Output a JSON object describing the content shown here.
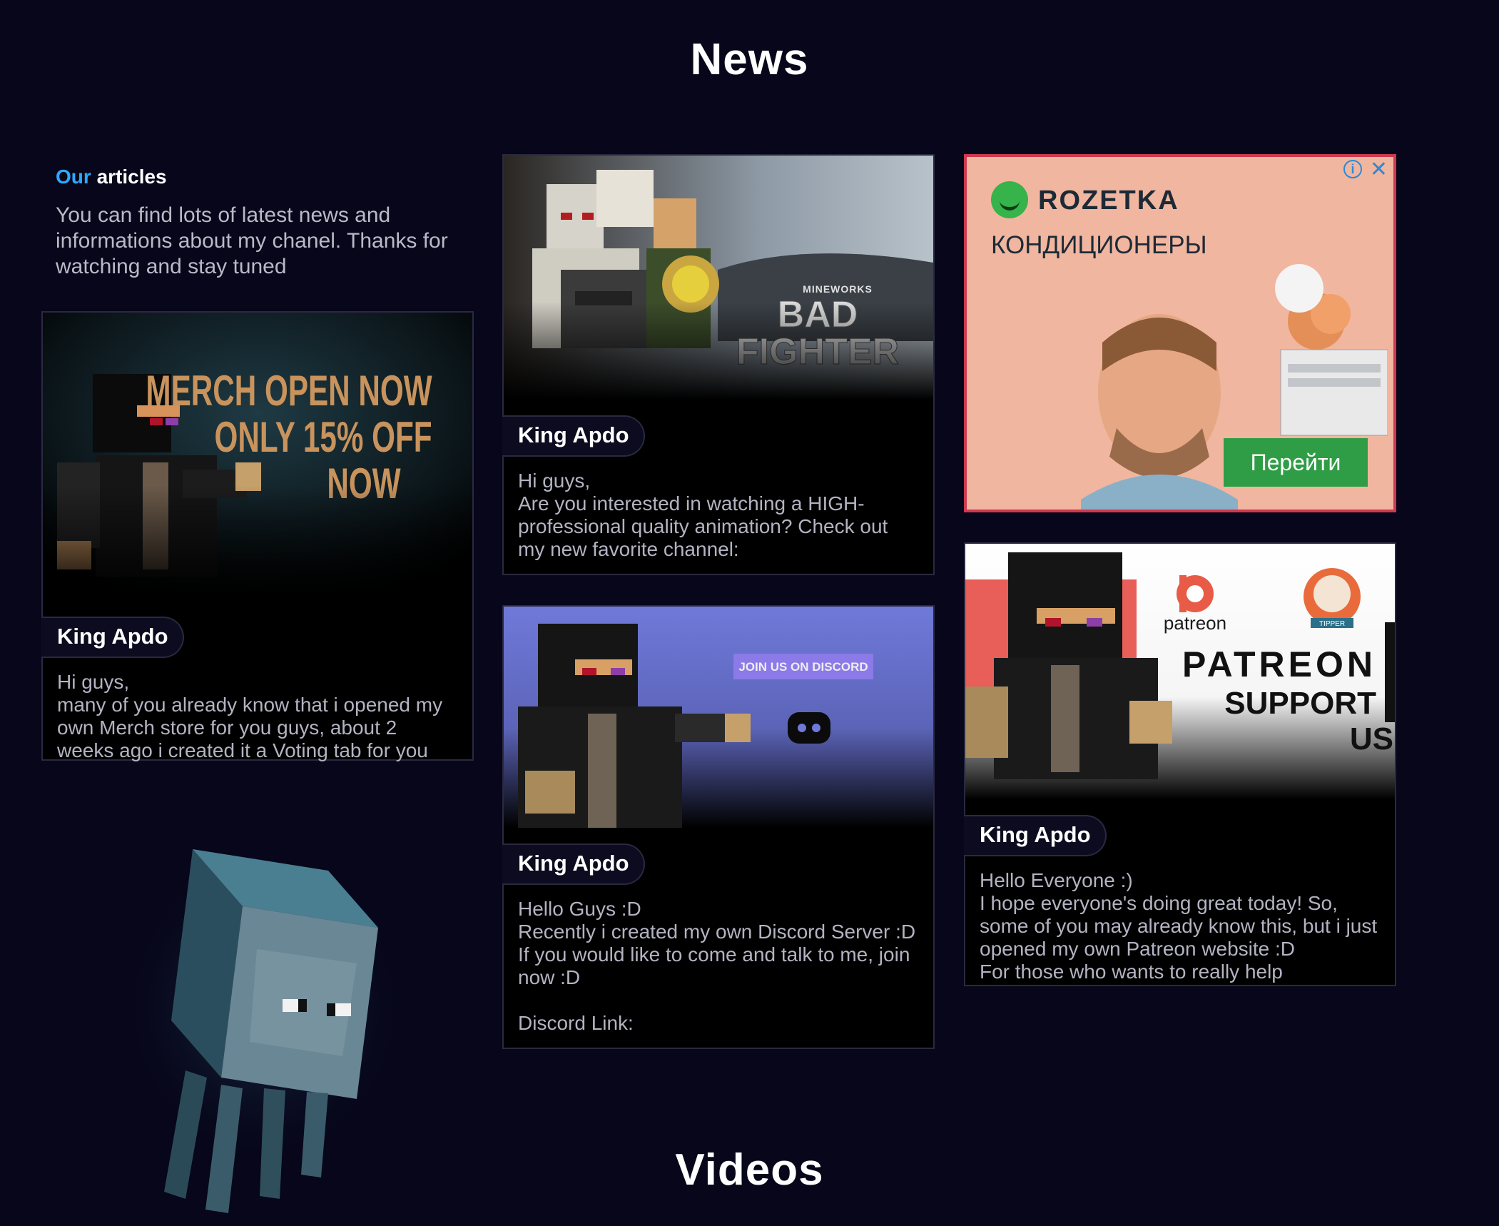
{
  "sections": {
    "news_title": "News",
    "videos_title": "Videos"
  },
  "intro": {
    "heading_accent": "Our",
    "heading_rest": "articles",
    "text": "You can find lots of latest news and informations about my chanel. Thanks for watching and stay tuned"
  },
  "cards": [
    {
      "author": "King Apdo",
      "body": "Hi guys,\nmany of you already know that i opened my own Merch store for you guys, about 2 weeks ago i created it a Voting tab for you",
      "thumb_text": [
        "MERCH OPEN NOW",
        "ONLY 15% OFF",
        "NOW"
      ]
    },
    {
      "author": "King Apdo",
      "body": "Hi guys,\nAre you interested in watching a HIGH-professional quality animation? Check out my new favorite channel:",
      "thumb_small": "MINEWORKS",
      "thumb_text": [
        "BAD",
        "FIGHTER"
      ]
    },
    {
      "author": "King Apdo",
      "body": "Hello Guys :D\nRecently i created my own Discord Server :D\nIf you would like to come and talk to me, join now :D\n\nDiscord Link:",
      "thumb_text": "JOIN US ON DISCORD"
    },
    {
      "author": "King Apdo",
      "body": "Hello Everyone :)\nI hope everyone's doing great today! So, some of you may already know this, but i just opened my own Patreon website :D\nFor those who wants to really help",
      "thumb_logo": "patreon",
      "thumb_badge": "TIPPER",
      "thumb_text": [
        "PATREON",
        "SUPPORT",
        "US"
      ]
    }
  ],
  "ad": {
    "brand": "ROZETKA",
    "headline": "КОНДИЦИОНЕРЫ",
    "cta": "Перейти",
    "info_icon": "info-icon",
    "close_icon": "close-icon"
  },
  "colors": {
    "background": "#07061a",
    "accent": "#2ea8ff",
    "ad_border": "#d0394f",
    "ad_cta": "#2f9d45"
  }
}
